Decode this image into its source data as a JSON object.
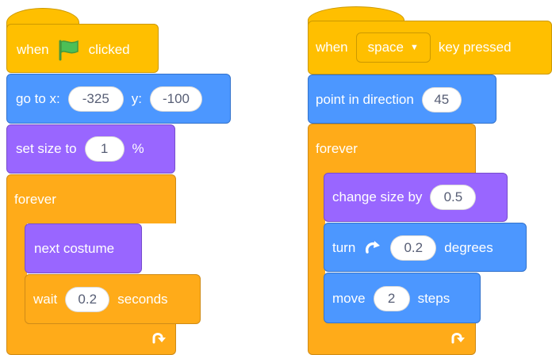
{
  "script_left": {
    "hat": {
      "prefix": "when",
      "suffix": "clicked",
      "icon": "green-flag-icon"
    },
    "goto": {
      "label_x": "go to x:",
      "x_value": "-325",
      "label_y": "y:",
      "y_value": "-100"
    },
    "set_size": {
      "label": "set size to",
      "value": "1",
      "unit": "%"
    },
    "forever": {
      "label": "forever"
    },
    "next_costume": {
      "label": "next costume"
    },
    "wait": {
      "label": "wait",
      "value": "0.2",
      "unit": "seconds"
    },
    "loop_icon": "loop-arrow-icon"
  },
  "script_right": {
    "hat": {
      "prefix": "when",
      "key": "space",
      "suffix": "key pressed"
    },
    "point": {
      "label": "point in direction",
      "value": "45"
    },
    "forever": {
      "label": "forever"
    },
    "change_size": {
      "label": "change size by",
      "value": "0.5"
    },
    "turn": {
      "label": "turn",
      "value": "0.2",
      "unit": "degrees",
      "icon": "rotate-clockwise-icon"
    },
    "move": {
      "label": "move",
      "value": "2",
      "unit": "steps"
    },
    "loop_icon": "loop-arrow-icon"
  },
  "colors": {
    "events": "#FFBF00",
    "motion": "#4C97FF",
    "looks": "#9966FF",
    "control": "#FFAB19",
    "flag": "#4CBF56"
  }
}
